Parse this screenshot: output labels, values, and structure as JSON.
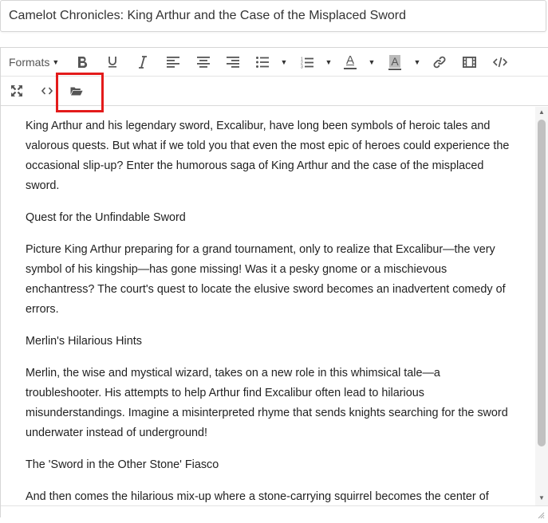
{
  "title_field": {
    "value": "Camelot Chronicles: King Arthur and the Case of the Misplaced Sword"
  },
  "toolbar": {
    "formats_label": "Formats",
    "buttons": [
      {
        "icon": "bold-icon"
      },
      {
        "icon": "underline-icon"
      },
      {
        "icon": "italic-icon"
      },
      {
        "icon": "align-left-icon"
      },
      {
        "icon": "align-center-icon"
      },
      {
        "icon": "align-right-icon"
      },
      {
        "icon": "bullet-list-icon"
      },
      {
        "icon": "numbered-list-icon"
      },
      {
        "icon": "text-color-icon"
      },
      {
        "icon": "background-color-icon"
      },
      {
        "icon": "link-icon"
      },
      {
        "icon": "media-icon"
      },
      {
        "icon": "code-icon"
      },
      {
        "icon": "fullscreen-icon"
      },
      {
        "icon": "source-code-icon"
      },
      {
        "icon": "open-folder-icon"
      }
    ],
    "text_color_letter": "A",
    "bg_color_letter": "A"
  },
  "highlight_color": "#e31b1b",
  "content": {
    "paragraphs": [
      "King Arthur and his legendary sword, Excalibur, have long been symbols of heroic tales and valorous quests. But what if we told you that even the most epic of heroes could experience the occasional slip-up? Enter the humorous saga of King Arthur and the case of the misplaced sword.",
      "Quest for the Unfindable Sword",
      "Picture King Arthur preparing for a grand tournament, only to realize that Excalibur—the very symbol of his kingship—has gone missing! Was it a pesky gnome or a mischievous enchantress? The court's quest to locate the elusive sword becomes an inadvertent comedy of errors.",
      "Merlin's Hilarious Hints",
      "Merlin, the wise and mystical wizard, takes on a new role in this whimsical tale—a troubleshooter. His attempts to help Arthur find Excalibur often lead to hilarious misunderstandings. Imagine a misinterpreted rhyme that sends knights searching for the sword underwater instead of underground!",
      "The 'Sword in the Other Stone' Fiasco",
      "And then comes the hilarious mix-up where a stone-carrying squirrel becomes the center of attention. As knights try to extract a sword from the 'other stone,' much to their bewilderment,"
    ]
  },
  "scrollbar": {
    "position_fraction": 0.0
  }
}
